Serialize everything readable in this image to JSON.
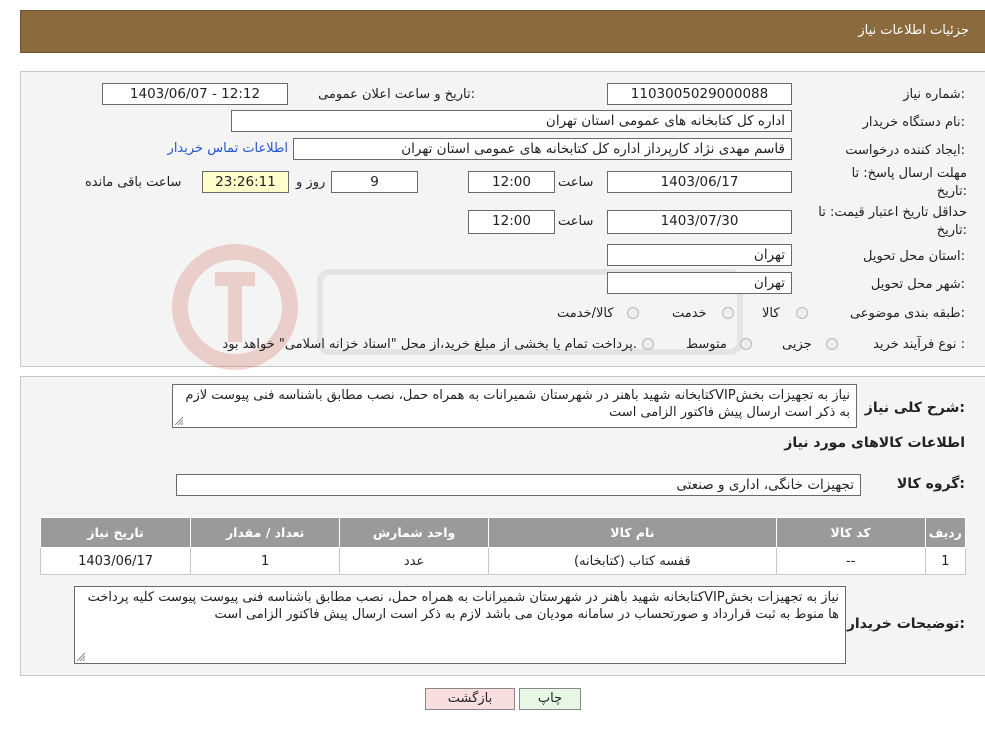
{
  "header": {
    "title": "جزئیات اطلاعات نیاز"
  },
  "form": {
    "need_number_label": "شماره نیاز:",
    "need_number": "1103005029000088",
    "announce_label": "تاریخ و ساعت اعلان عمومی:",
    "announce_value": "1403/06/07 - 12:12",
    "buyer_label": "نام دستگاه خریدار:",
    "buyer_value": "اداره کل کتابخانه های عمومی استان تهران",
    "creator_label": "ایجاد کننده درخواست:",
    "creator_value": "قاسم مهدی نژاد کارپرداز اداره کل کتابخانه های عمومی استان تهران",
    "contact_link": "اطلاعات تماس خریدار",
    "deadline_label": "مهلت ارسال پاسخ: تا تاریخ:",
    "deadline_date": "1403/06/17",
    "time_label": "ساعت",
    "deadline_time": "12:00",
    "days_value": "9",
    "days_label": "روز و",
    "remaining_time": "23:26:11",
    "remaining_label": "ساعت باقی مانده",
    "validity_label": "حداقل تاریخ اعتبار قیمت: تا تاریخ:",
    "validity_date": "1403/07/30",
    "validity_time": "12:00",
    "province_label": "استان محل تحویل:",
    "province_value": "تهران",
    "city_label": "شهر محل تحویل:",
    "city_value": "تهران",
    "category_label": "طبقه بندی موضوعی:",
    "category_options": [
      "کالا",
      "خدمت",
      "کالا/خدمت"
    ],
    "process_label": "نوع فرآیند خرید :",
    "process_options": [
      "جزیی",
      "متوسط"
    ],
    "process_note": "پرداخت تمام یا بخشی از مبلغ خرید،از محل \"اسناد خزانه اسلامی\" خواهد بود."
  },
  "description": {
    "label": "شرح کلی نیاز:",
    "text": "نیاز به تجهیزات بخشVIPکتابخانه شهید باهنر در شهرستان شمیرانات به همراه حمل، نصب مطابق باشناسه فنی پیوست لازم به ذکر است  ارسال پیش فاکتور الزامی است"
  },
  "goods": {
    "section_title": "اطلاعات کالاهای مورد نیاز",
    "group_label": "گروه کالا:",
    "group_value": "تجهیزات خانگی، اداری و صنعتی",
    "columns": [
      "ردیف",
      "کد کالا",
      "نام کالا",
      "واحد شمارش",
      "تعداد / مقدار",
      "تاریخ نیاز"
    ],
    "rows": [
      [
        "1",
        "--",
        "قفسه کتاب (کتابخانه)",
        "عدد",
        "1",
        "1403/06/17"
      ]
    ]
  },
  "buyer_notes": {
    "label": "توضیحات خریدار:",
    "text": "نیاز به تجهیزات بخشVIPکتابخانه شهید باهنر در شهرستان شمیرانات به همراه حمل، نصب مطابق باشناسه فنی پیوست پیوست کلیه پرداخت ها منوط به ثبت قرارداد و صورتحساب در سامانه مودیان می باشد لازم به ذکر است ارسال پیش فاکتور الزامی است"
  },
  "buttons": {
    "print": "چاپ",
    "back": "بازگشت"
  },
  "colors": {
    "header": "#8b6a3e",
    "table_header": "#9a9a9a",
    "highlight": "#ffffcc",
    "back_button": "#f8dede",
    "print_button": "#e6f7e6"
  }
}
